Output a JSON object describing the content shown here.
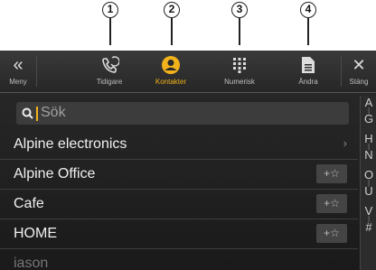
{
  "callouts": [
    "1",
    "2",
    "3",
    "4"
  ],
  "tabs": {
    "menu": {
      "label": "Meny"
    },
    "recent": {
      "label": "Tidigare"
    },
    "contacts": {
      "label": "Kontakter"
    },
    "numeric": {
      "label": "Numerisk"
    },
    "edit": {
      "label": "Ändra"
    },
    "close": {
      "label": "Stäng"
    }
  },
  "colors": {
    "accent": "#f2b21b",
    "background": "#1f1f1f"
  },
  "search": {
    "placeholder": "Sök"
  },
  "contacts": [
    {
      "name": "Alpine electronics",
      "action": "›"
    },
    {
      "name": "Alpine Office",
      "action": "+☆"
    },
    {
      "name": "Cafe",
      "action": "+☆"
    },
    {
      "name": "HOME",
      "action": "+☆"
    },
    {
      "name": "iason",
      "action": ""
    }
  ],
  "alphabet": [
    "A",
    "G",
    "H",
    "N",
    "O",
    "U",
    "V",
    "#"
  ]
}
